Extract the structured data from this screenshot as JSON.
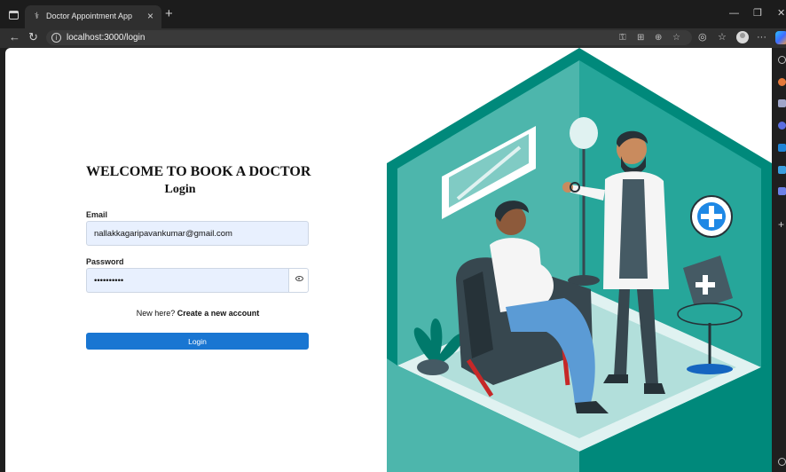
{
  "browser": {
    "tab_title": "Doctor Appointment App",
    "url": "localhost:3000/login",
    "new_tab": "+",
    "close": "×"
  },
  "form": {
    "heading": "WELCOME TO BOOK A DOCTOR",
    "subheading": "Login",
    "email_label": "Email",
    "email_value": "nallakkagaripavankumar@gmail.com",
    "password_label": "Password",
    "password_value": "••••••••••",
    "new_here": "New here?",
    "create_link": "Create a new account",
    "login_button": "Login"
  },
  "colors": {
    "accent": "#1976d2",
    "field_bg": "#e8f0fe",
    "illustration_teal": "#26a69a"
  },
  "icons": [
    "window-icon",
    "tab-favicon",
    "back-icon",
    "reload-icon",
    "info-icon",
    "key-icon",
    "grid-icon",
    "zoom-icon",
    "star-icon",
    "shield-icon",
    "favorites-icon",
    "profile-icon",
    "more-icon",
    "copilot-icon",
    "eye-icon"
  ]
}
